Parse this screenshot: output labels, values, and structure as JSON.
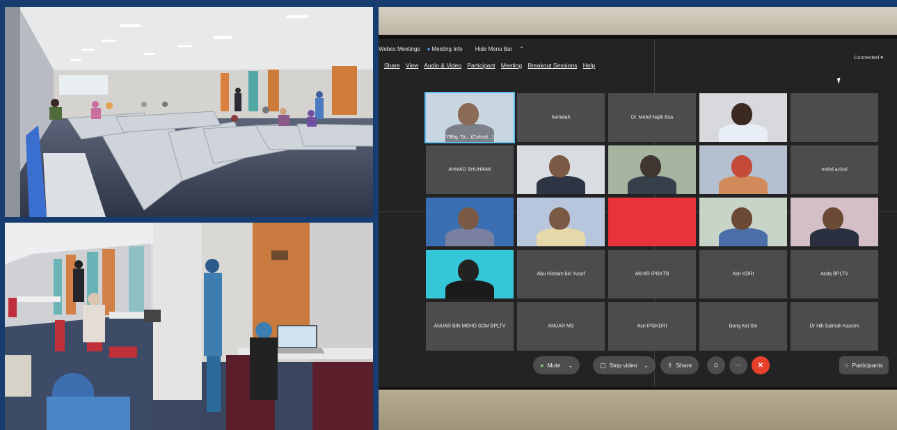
{
  "webex": {
    "menubar_top": [
      "Webex Meetings",
      "Meeting Info",
      "Hide Menu Bar"
    ],
    "menu": [
      "Share",
      "View",
      "Audio & Video",
      "Participant",
      "Meeting",
      "Breakout Sessions",
      "Help"
    ],
    "status": "Connected",
    "tiles": [
      {
        "name": "YBhg. Ta... (Cohost...)",
        "video": true,
        "active": true
      },
      {
        "name": "hamidah",
        "video": false
      },
      {
        "name": "Dr. Mohd Najib Esa",
        "video": false
      },
      {
        "name": "",
        "video": true
      },
      {
        "name": "",
        "video": false
      },
      {
        "name": "AHMAD SHUHAIMI",
        "video": false
      },
      {
        "name": "",
        "video": true
      },
      {
        "name": "",
        "video": true
      },
      {
        "name": "",
        "video": true
      },
      {
        "name": "mohd azizul",
        "video": false
      },
      {
        "name": "",
        "video": true
      },
      {
        "name": "",
        "video": true
      },
      {
        "name": "",
        "video": true
      },
      {
        "name": "",
        "video": true
      },
      {
        "name": "",
        "video": true
      },
      {
        "name": "",
        "video": true
      },
      {
        "name": "Abu Hisham bin Yusof",
        "video": false
      },
      {
        "name": "AKHIR IPGKTB",
        "video": false
      },
      {
        "name": "Asri KDRI",
        "video": false
      },
      {
        "name": "Anita BPLTV",
        "video": false
      },
      {
        "name": "ANUAR BIN MOHD SOM BPLTV",
        "video": false
      },
      {
        "name": "ANUAR MS",
        "video": false
      },
      {
        "name": "Asri IPGKDRI",
        "video": false
      },
      {
        "name": "Bong Kei Sin",
        "video": false
      },
      {
        "name": "Dr Hjh Salmah Kassim",
        "video": false
      }
    ],
    "controls": {
      "mute": "Mute",
      "stop_video": "Stop video",
      "share": "Share",
      "participants": "Participants"
    }
  }
}
